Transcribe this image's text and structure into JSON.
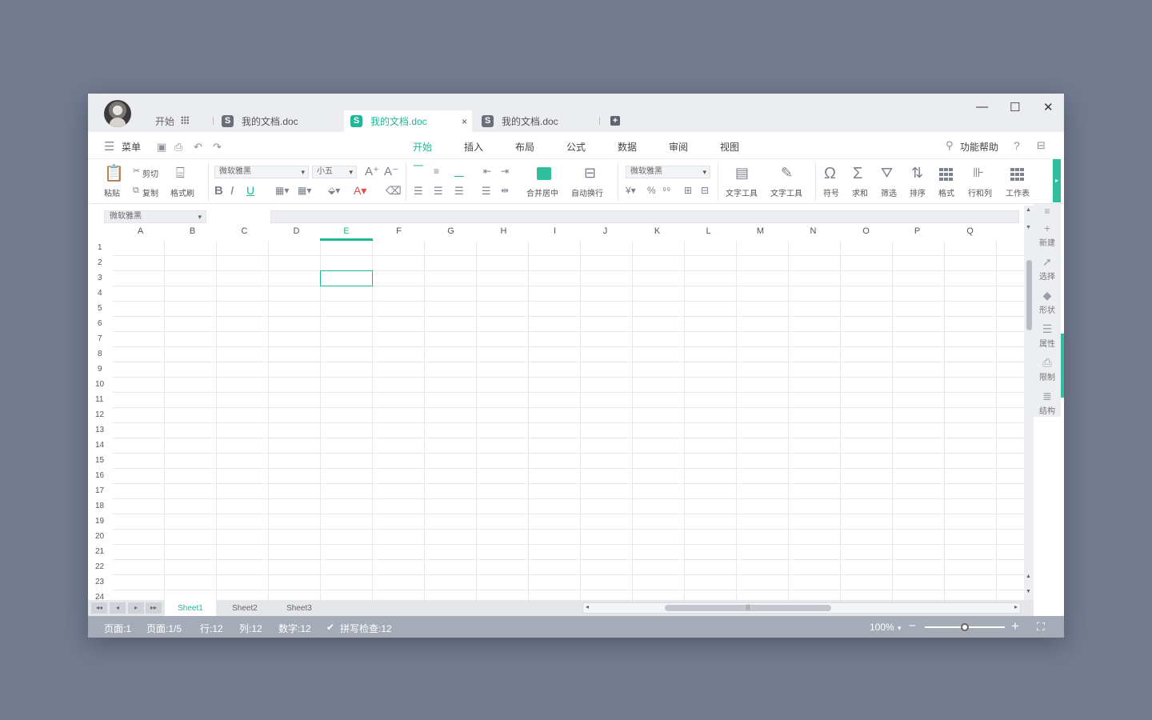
{
  "titlebar": {
    "home_label": "开始",
    "tabs": [
      {
        "label": "我的文档.doc",
        "icon": "S"
      },
      {
        "label": "我的文档.doc",
        "icon": "S",
        "close": "×"
      },
      {
        "label": "我的文档.doc",
        "icon": "S"
      }
    ],
    "new_tab": "+",
    "minimize": "—",
    "maximize": "☐",
    "close": "✕"
  },
  "menu": {
    "menu_label": "菜单",
    "items": [
      "开始",
      "插入",
      "布局",
      "公式",
      "数据",
      "审阅",
      "视图"
    ],
    "active": "开始",
    "help_label": "功能帮助",
    "question": "?"
  },
  "ribbon": {
    "paste": "粘贴",
    "cut": "剪切",
    "copy": "复制",
    "format_painter": "格式刷",
    "font_name": "微软雅黑",
    "font_size": "小五",
    "merge_center": "合并居中",
    "auto_wrap": "自动换行",
    "number_font": "微软雅黑",
    "text_tool_1": "文字工具",
    "text_tool_2": "文字工具",
    "symbol": "符号",
    "sum": "求和",
    "filter": "筛选",
    "sort": "排序",
    "format": "格式",
    "row_col": "行和列",
    "worksheet": "工作表"
  },
  "formula_bar": {
    "name_box": "微软雅黑",
    "content": ""
  },
  "sheet": {
    "columns": [
      "A",
      "B",
      "C",
      "D",
      "E",
      "F",
      "G",
      "H",
      "I",
      "J",
      "K",
      "L",
      "M",
      "N",
      "O",
      "P",
      "Q"
    ],
    "active_column": "E",
    "rows": [
      "1",
      "2",
      "3",
      "4",
      "5",
      "6",
      "7",
      "8",
      "9",
      "10",
      "11",
      "12",
      "13",
      "14",
      "15",
      "16",
      "17",
      "18",
      "19",
      "20",
      "21",
      "22",
      "23",
      "24"
    ],
    "selected_cell": "E3"
  },
  "sidebar": [
    {
      "label": "新建",
      "icon": "plus-icon"
    },
    {
      "label": "选择",
      "icon": "cursor-icon"
    },
    {
      "label": "形状",
      "icon": "shapes-icon"
    },
    {
      "label": "属性",
      "icon": "sliders-icon"
    },
    {
      "label": "限制",
      "icon": "lock-icon"
    },
    {
      "label": "结构",
      "icon": "structure-icon"
    }
  ],
  "sheet_tabs": [
    "Sheet1",
    "Sheet2",
    "Sheet3"
  ],
  "active_sheet": "Sheet1",
  "status": {
    "page": "页面:1",
    "pages": "页面:1/5",
    "row": "行:12",
    "col": "列:12",
    "count": "数字:12",
    "spell": "拼写检查:12",
    "zoom": "100%",
    "zoom_minus": "−",
    "zoom_plus": "+",
    "zoom_level": 0.5
  },
  "colors": {
    "accent": "#1fb796",
    "background": "#737b91",
    "status_bar": "#a6abb8"
  }
}
